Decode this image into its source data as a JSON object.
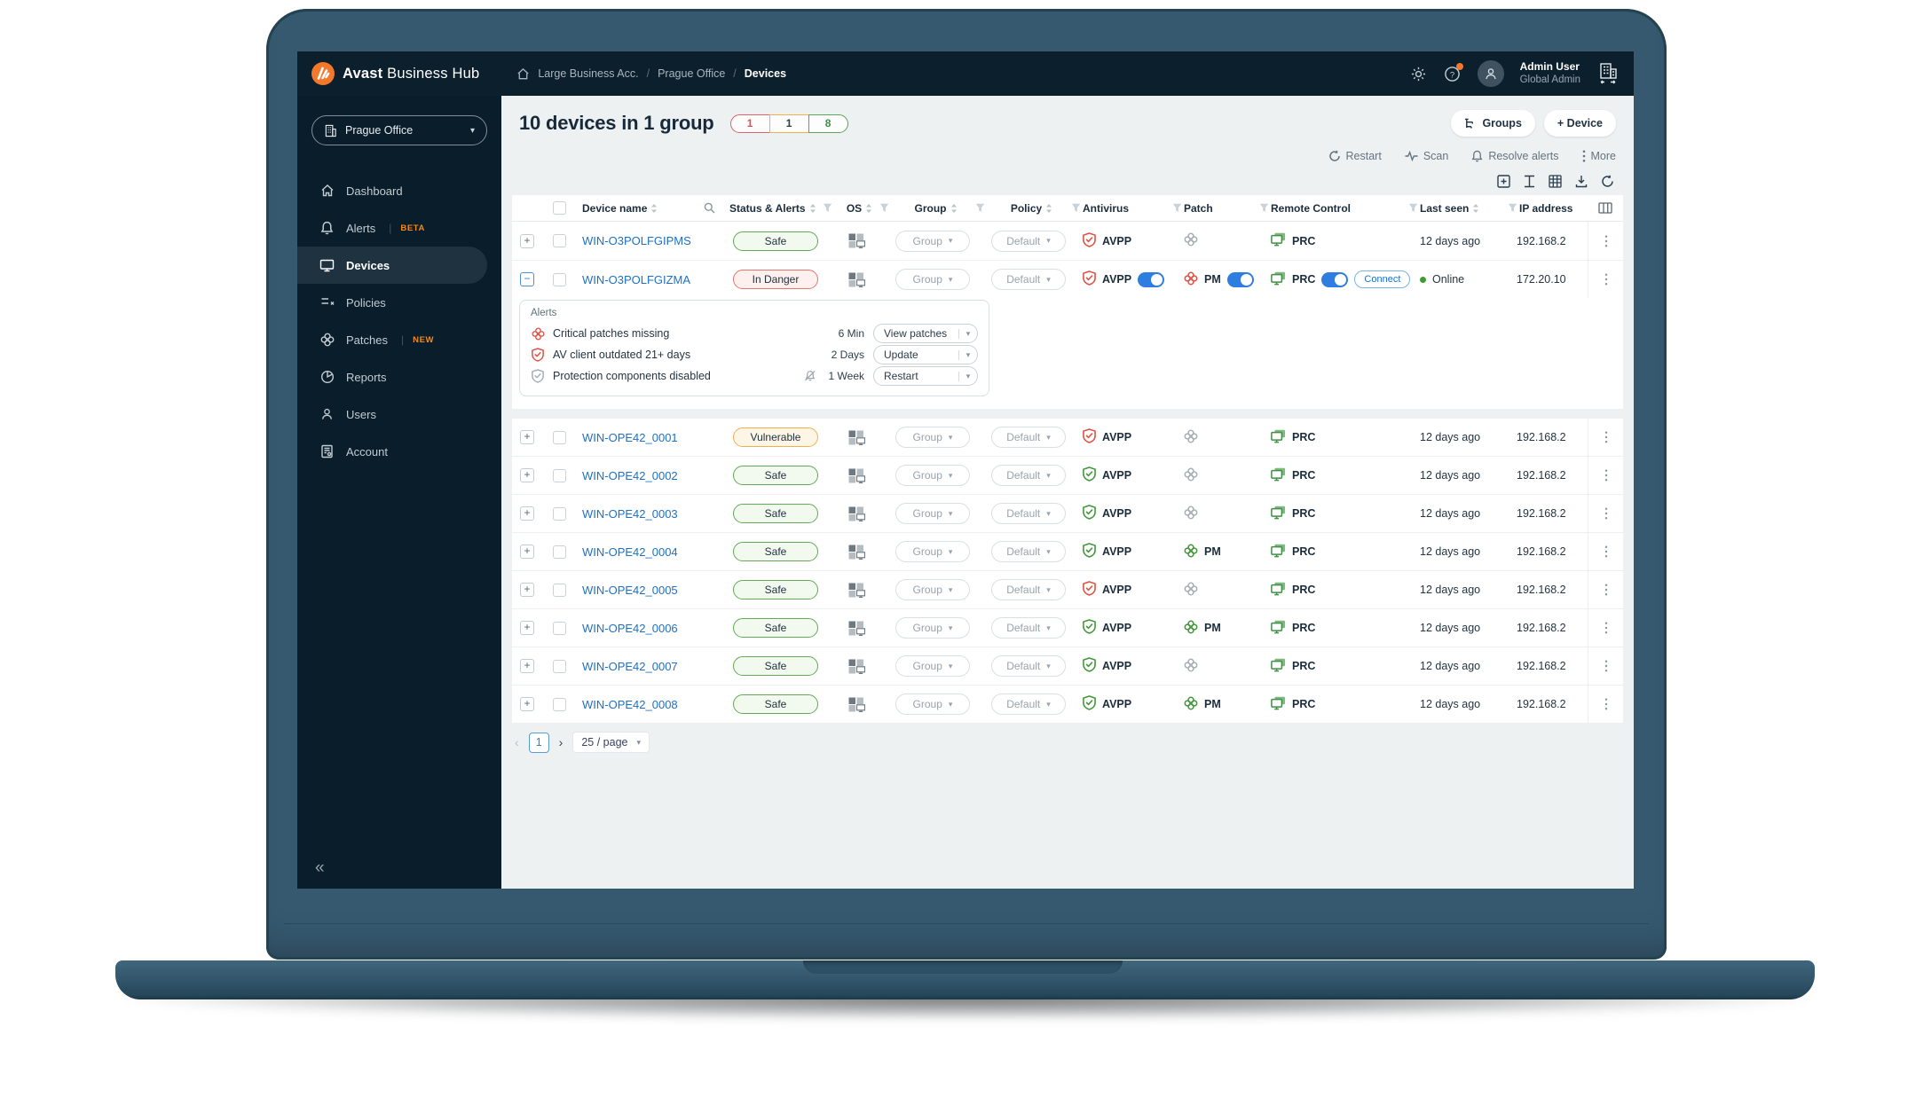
{
  "brand": {
    "name_bold": "Avast",
    "name_rest": "Business Hub"
  },
  "topbar": {
    "breadcrumbs": [
      {
        "label": "Large Business Acc."
      },
      {
        "label": "Prague Office"
      },
      {
        "label": "Devices",
        "current": true
      }
    ],
    "user": {
      "name": "Admin User",
      "role": "Global Admin"
    }
  },
  "sidebar": {
    "org_selector": {
      "label": "Prague Office"
    },
    "items": [
      {
        "id": "dashboard",
        "label": "Dashboard"
      },
      {
        "id": "alerts",
        "label": "Alerts",
        "badge": "BETA"
      },
      {
        "id": "devices",
        "label": "Devices",
        "active": true
      },
      {
        "id": "policies",
        "label": "Policies"
      },
      {
        "id": "patches",
        "label": "Patches",
        "badge": "NEW"
      },
      {
        "id": "reports",
        "label": "Reports"
      },
      {
        "id": "users",
        "label": "Users"
      },
      {
        "id": "account",
        "label": "Account"
      }
    ]
  },
  "page": {
    "title": "10 devices in 1 group",
    "counts": [
      {
        "value": "1",
        "type": "danger"
      },
      {
        "value": "1",
        "type": "warning"
      },
      {
        "value": "8",
        "type": "success"
      }
    ],
    "buttons": {
      "groups": "Groups",
      "device": "+ Device"
    },
    "actions": {
      "restart": "Restart",
      "scan": "Scan",
      "resolve": "Resolve alerts",
      "more": "More"
    }
  },
  "table": {
    "columns": [
      {
        "label": "Device name",
        "sort": true,
        "search": true
      },
      {
        "label": "Status & Alerts",
        "sort": true,
        "filter": true
      },
      {
        "label": "OS",
        "sort": true,
        "filter": true,
        "center": true
      },
      {
        "label": "Group",
        "sort": true,
        "filter": true,
        "center": true
      },
      {
        "label": "Policy",
        "sort": true,
        "filter": true,
        "center": true
      },
      {
        "label": "Antivirus",
        "filter": true
      },
      {
        "label": "Patch",
        "filter": true
      },
      {
        "label": "Remote Control",
        "filter": true
      },
      {
        "label": "Last seen",
        "sort": true,
        "filter": true
      },
      {
        "label": "IP address",
        "clipped": true
      }
    ],
    "dropdowns": {
      "group": "Group",
      "policy": "Default"
    },
    "rows": [
      {
        "name": "WIN-O3POLFGIPMS",
        "status": "Safe",
        "status_type": "safe",
        "av": {
          "label": "AVPP",
          "color": "red"
        },
        "patch": {
          "color": "gray"
        },
        "rc": {
          "label": "PRC"
        },
        "last_seen": "12 days ago",
        "ip": "192.168.2"
      },
      {
        "name": "WIN-O3POLFGIZMA",
        "status": "In Danger",
        "status_type": "danger",
        "expanded": true,
        "av": {
          "label": "AVPP",
          "color": "red",
          "toggle": true
        },
        "patch": {
          "color": "red",
          "label": "PM",
          "toggle": true
        },
        "rc": {
          "label": "PRC",
          "toggle": true,
          "connect": "Connect"
        },
        "online": "Online",
        "ip": "172.20.10"
      },
      {
        "name": "WIN-OPE42_0001",
        "status": "Vulnerable",
        "status_type": "warn",
        "av": {
          "label": "AVPP",
          "color": "red"
        },
        "patch": {
          "color": "gray"
        },
        "rc": {
          "label": "PRC"
        },
        "last_seen": "12 days ago",
        "ip": "192.168.2"
      },
      {
        "name": "WIN-OPE42_0002",
        "status": "Safe",
        "status_type": "safe",
        "av": {
          "label": "AVPP",
          "color": "green"
        },
        "patch": {
          "color": "gray"
        },
        "rc": {
          "label": "PRC"
        },
        "last_seen": "12 days ago",
        "ip": "192.168.2"
      },
      {
        "name": "WIN-OPE42_0003",
        "status": "Safe",
        "status_type": "safe",
        "av": {
          "label": "AVPP",
          "color": "green"
        },
        "patch": {
          "color": "gray"
        },
        "rc": {
          "label": "PRC"
        },
        "last_seen": "12 days ago",
        "ip": "192.168.2"
      },
      {
        "name": "WIN-OPE42_0004",
        "status": "Safe",
        "status_type": "safe",
        "av": {
          "label": "AVPP",
          "color": "green"
        },
        "patch": {
          "color": "green",
          "label": "PM"
        },
        "rc": {
          "label": "PRC"
        },
        "last_seen": "12 days ago",
        "ip": "192.168.2"
      },
      {
        "name": "WIN-OPE42_0005",
        "status": "Safe",
        "status_type": "safe",
        "av": {
          "label": "AVPP",
          "color": "red"
        },
        "patch": {
          "color": "gray"
        },
        "rc": {
          "label": "PRC"
        },
        "last_seen": "12 days ago",
        "ip": "192.168.2"
      },
      {
        "name": "WIN-OPE42_0006",
        "status": "Safe",
        "status_type": "safe",
        "av": {
          "label": "AVPP",
          "color": "green"
        },
        "patch": {
          "color": "green",
          "label": "PM"
        },
        "rc": {
          "label": "PRC"
        },
        "last_seen": "12 days ago",
        "ip": "192.168.2"
      },
      {
        "name": "WIN-OPE42_0007",
        "status": "Safe",
        "status_type": "safe",
        "av": {
          "label": "AVPP",
          "color": "green"
        },
        "patch": {
          "color": "gray"
        },
        "rc": {
          "label": "PRC"
        },
        "last_seen": "12 days ago",
        "ip": "192.168.2"
      },
      {
        "name": "WIN-OPE42_0008",
        "status": "Safe",
        "status_type": "safe",
        "av": {
          "label": "AVPP",
          "color": "green"
        },
        "patch": {
          "color": "green",
          "label": "PM"
        },
        "rc": {
          "label": "PRC"
        },
        "last_seen": "12 days ago",
        "ip": "192.168.2"
      }
    ]
  },
  "alerts_panel": {
    "title": "Alerts",
    "items": [
      {
        "icon": "patch-icon",
        "severity": "red",
        "text": "Critical patches missing",
        "time": "6 Min",
        "action": "View patches"
      },
      {
        "icon": "shield-icon",
        "severity": "red",
        "text": "AV client outdated 21+ days",
        "time": "2 Days",
        "action": "Update"
      },
      {
        "icon": "shield-icon",
        "severity": "gray",
        "muted_bell": true,
        "text": "Protection components disabled",
        "time": "1 Week",
        "action": "Restart"
      }
    ]
  },
  "pagination": {
    "page": "1",
    "page_size": "25 / page"
  },
  "colors": {
    "brand_orange": "#f3782a",
    "accent_blue": "#2e7de0",
    "safe_green": "#63a857",
    "danger_red": "#e4756a",
    "warning_yellow": "#eeb24c",
    "link_blue": "#1d70c8",
    "badge_orange": "#f28a1e"
  }
}
